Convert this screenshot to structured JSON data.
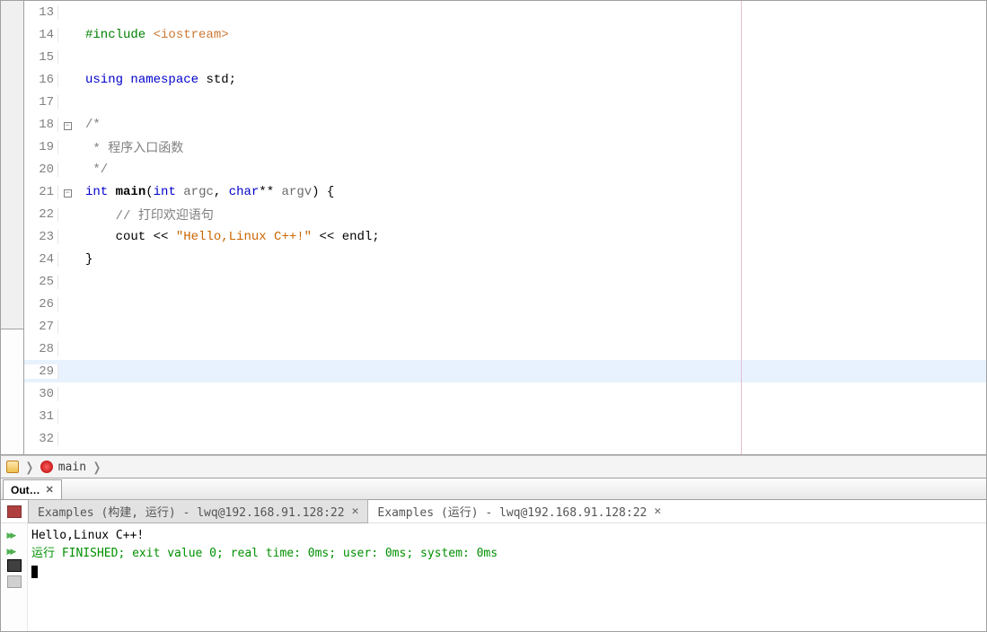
{
  "editor": {
    "line_start": 13,
    "lines": [
      {
        "n": 13,
        "fold": "",
        "html": ""
      },
      {
        "n": 14,
        "fold": "",
        "html": "<span class='tok-pp'>#include</span> <span class='tok-string-angle'>&lt;iostream&gt;</span>"
      },
      {
        "n": 15,
        "fold": "",
        "html": ""
      },
      {
        "n": 16,
        "fold": "",
        "html": "<span class='tok-kw'>using</span> <span class='tok-kw'>namespace</span> <span class='tok-id'>std</span>;"
      },
      {
        "n": 17,
        "fold": "",
        "html": ""
      },
      {
        "n": 18,
        "fold": "box",
        "html": "<span class='tok-comment'>/*</span>"
      },
      {
        "n": 19,
        "fold": "line",
        "html": "<span class='tok-comment'> * 程序入口函数</span>"
      },
      {
        "n": 20,
        "fold": "line",
        "html": "<span class='tok-comment'> */</span>"
      },
      {
        "n": 21,
        "fold": "box",
        "html": "<span class='tok-type'>int</span> <span class='tok-func'>main</span>(<span class='tok-type'>int</span> <span class='tok-param'>argc</span>, <span class='tok-type'>char</span>** <span class='tok-param'>argv</span>) {"
      },
      {
        "n": 22,
        "fold": "line",
        "html": "    <span class='tok-comment'>// 打印欢迎语句</span>"
      },
      {
        "n": 23,
        "fold": "line",
        "html": "    cout <span class='tok-op'>&lt;&lt;</span> <span class='tok-string'>\"Hello,Linux C++!\"</span> <span class='tok-op'>&lt;&lt;</span> endl;"
      },
      {
        "n": 24,
        "fold": "end",
        "html": "}"
      },
      {
        "n": 25,
        "fold": "",
        "html": ""
      },
      {
        "n": 26,
        "fold": "",
        "html": ""
      },
      {
        "n": 27,
        "fold": "",
        "html": ""
      },
      {
        "n": 28,
        "fold": "",
        "html": ""
      },
      {
        "n": 29,
        "fold": "",
        "html": "",
        "hl": true
      },
      {
        "n": 30,
        "fold": "",
        "html": ""
      },
      {
        "n": 31,
        "fold": "",
        "html": ""
      },
      {
        "n": 32,
        "fold": "",
        "html": ""
      }
    ]
  },
  "breadcrumb": {
    "func": "main"
  },
  "output": {
    "tab_label": "Out…",
    "subtabs": [
      {
        "label": "Examples (构建, 运行) - lwq@192.168.91.128:22",
        "active": true
      },
      {
        "label": "Examples (运行) - lwq@192.168.91.128:22",
        "active": false
      }
    ],
    "lines": [
      {
        "text": "Hello,Linux C++!",
        "cls": ""
      },
      {
        "text": "",
        "cls": ""
      },
      {
        "text": "运行 FINISHED; exit value 0; real time: 0ms; user: 0ms; system: 0ms",
        "cls": "green"
      }
    ]
  }
}
